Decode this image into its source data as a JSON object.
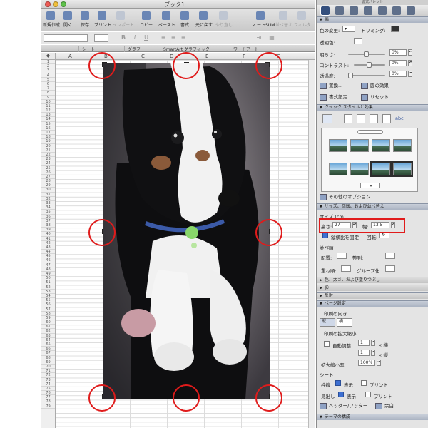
{
  "window": {
    "title": "ブック1"
  },
  "toolbar": {
    "buttons": [
      "新規作成",
      "開く",
      "保存",
      "プリント",
      "インポート",
      "コピー",
      "ペースト",
      "書式",
      "元に戻す",
      "やり直し",
      "オートSUM",
      "並べ替え",
      "フィルタ"
    ]
  },
  "ribbon": {
    "tabs": [
      "シート",
      "グラフ",
      "SmartArt グラフィック",
      "ワードアート"
    ]
  },
  "sheet": {
    "columns": [
      "A",
      "B",
      "C",
      "D",
      "E",
      "F",
      "G"
    ],
    "row_count": 79
  },
  "palette": {
    "title": "書式パレット",
    "image_section": "画",
    "color_mode_label": "色の変更:",
    "trimming_label": "トリミング:",
    "transparent_label": "透明色:",
    "brightness_label": "明るさ:",
    "brightness_value": "0%",
    "contrast_label": "コントラスト:",
    "contrast_value": "0%",
    "transparency_label": "透過度:",
    "transparency_value": "0%",
    "replace_button": "置換...",
    "effects_button": "図の効果",
    "format_button": "書式設定...",
    "reset_button": "リセット",
    "quick_styles": "クイック スタイルと効果",
    "other_options": "その他のオプション...",
    "size_section": "サイズ、回転、および並べ替え",
    "size_label": "サイズ (cm)",
    "height_label": "高さ:",
    "height_value": "27",
    "width_label": "幅:",
    "width_value": "13.5",
    "lock_aspect": "縦横比を固定",
    "rotation_label": "回転:",
    "arrange_label": "並び順",
    "align_label": "配置:",
    "distribute_label": "整列:",
    "order_label": "重ね順:",
    "group_label": "グループ化",
    "color_section": "色、太さ、および塗りつぶし",
    "shadow_section": "影",
    "reflection_section": "反射",
    "page_section": "ページ設定",
    "orientation_label": "印刷の向き",
    "portrait_label": "縦",
    "landscape_label": "横",
    "scale_label": "印刷の拡大縮小",
    "fit_label": "自動調整",
    "fit_w": "1",
    "fit_h": "1",
    "fit_x_w": "× 横",
    "fit_x_h": "× 縦",
    "zoom_label": "拡大縮小率",
    "zoom_value": "100%",
    "sheet_label": "シート",
    "gridlines_label": "枠線",
    "show_label": "表示",
    "print_label": "プリント",
    "headings_label": "見出し",
    "show2_label": "表示",
    "print2_label": "プリント",
    "header_button": "ヘッダー/フッター...",
    "margins_button": "余白...",
    "theme_section": "テーマの構成"
  }
}
